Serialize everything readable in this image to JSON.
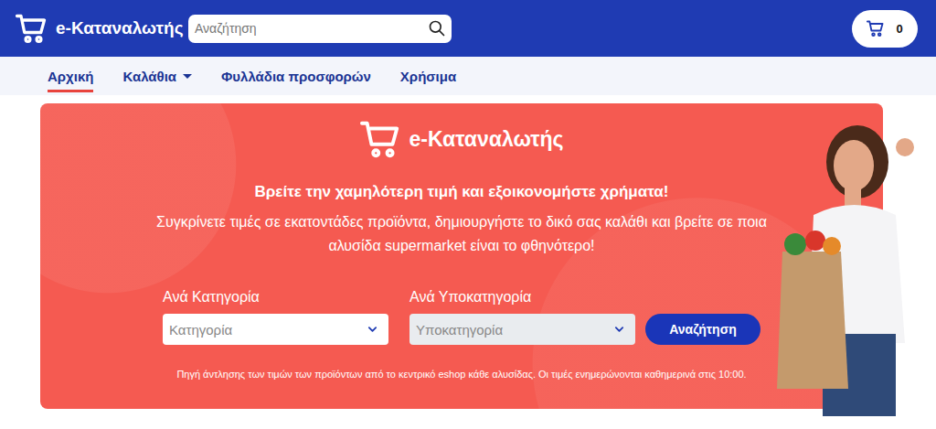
{
  "header": {
    "logo": "e-Καταναλωτής",
    "search_placeholder": "Αναζήτηση",
    "cart_count": "0"
  },
  "nav": [
    {
      "label": "Αρχική",
      "selected": true,
      "dropdown": false
    },
    {
      "label": "Καλάθια",
      "selected": false,
      "dropdown": true
    },
    {
      "label": "Φυλλάδια προσφορών",
      "selected": false,
      "dropdown": false
    },
    {
      "label": "Χρήσιμα",
      "selected": false,
      "dropdown": false
    }
  ],
  "hero": {
    "logo": "e-Καταναλωτής",
    "title": "Βρείτε την χαμηλότερη τιμή και εξοικονομήστε χρήματα!",
    "subtitle": "Συγκρίνετε τιμές σε εκατοντάδες προϊόντα, δημιουργήστε το δικό σας καλάθι και βρείτε σε ποια αλυσίδα supermarket είναι το φθηνότερο!",
    "filters": [
      {
        "label": "Ανά Κατηγορία",
        "placeholder": "Κατηγορία",
        "disabled": false
      },
      {
        "label": "Ανά Υποκατηγορία",
        "placeholder": "Υποκατηγορία",
        "disabled": true
      }
    ],
    "button": "Αναζήτηση",
    "note": "Πηγή άντλησης των τιμών των προϊόντων από το κεντρικό eshop κάθε αλυσίδας. Οι τιμές ενημερώνονται καθημερινά στις 10:00."
  }
}
